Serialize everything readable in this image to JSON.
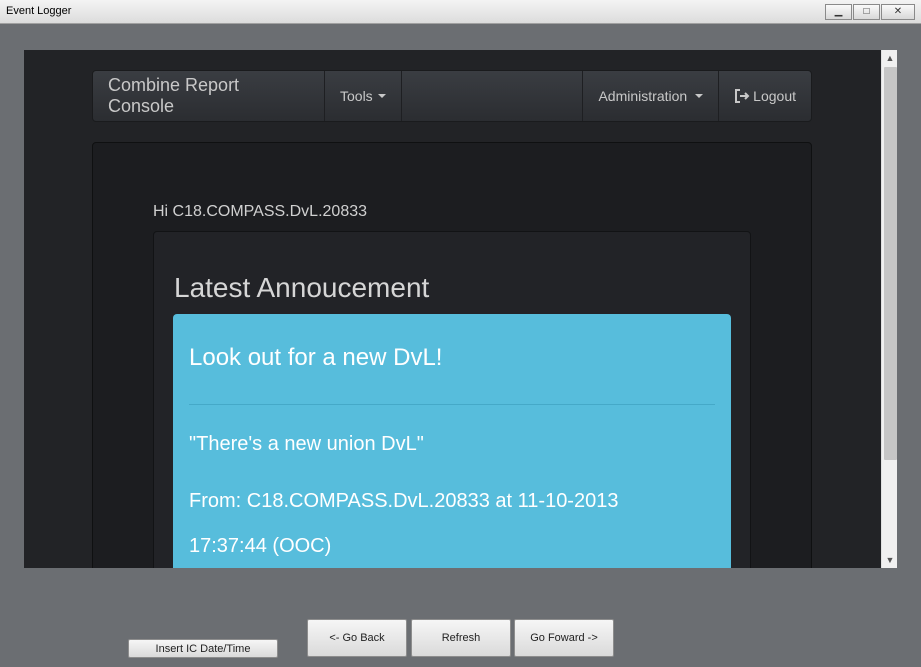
{
  "window": {
    "title": "Event Logger",
    "minimize_icon": "minimize-icon",
    "maximize_icon": "maximize-icon",
    "close_label": "✕"
  },
  "navbar": {
    "brand": "Combine Report Console",
    "tools_label": "Tools",
    "administration_label": "Administration",
    "logout_label": "Logout",
    "logout_icon": "logout-icon"
  },
  "content": {
    "greeting": "Hi C18.COMPASS.DvL.20833",
    "section_title": "Latest Annoucement",
    "announcement": {
      "heading": "Look out for a new DvL!",
      "body": "\"There's a new union DvL\"",
      "from_line": "From: C18.COMPASS.DvL.20833 at 11-10-2013",
      "time_line": "17:37:44 (OOC)"
    }
  },
  "buttons": {
    "insert_ic": "Insert IC Date/Time",
    "go_back": "<- Go Back",
    "refresh": "Refresh",
    "go_forward": "Go Foward ->"
  },
  "colors": {
    "alert_bg": "#57bddc",
    "page_bg": "#222326"
  }
}
